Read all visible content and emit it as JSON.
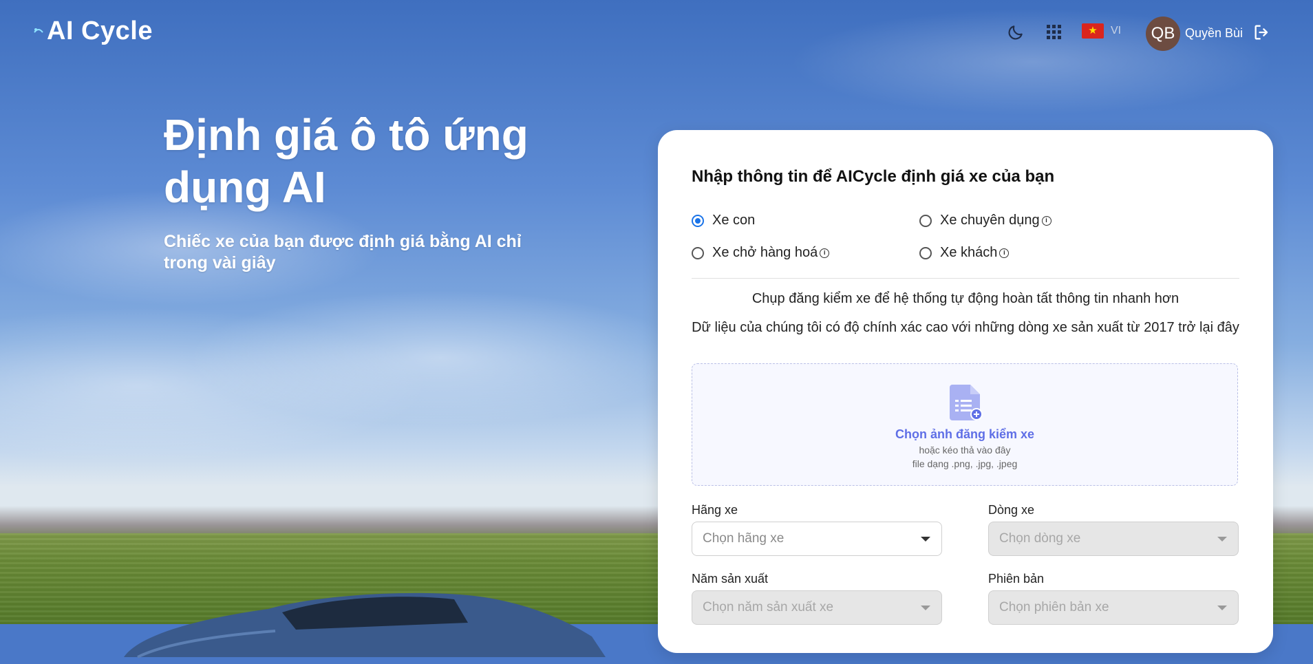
{
  "header": {
    "logo_text": "AI Cycle",
    "icons": [
      "moon-icon",
      "apps-grid-icon",
      "logout-icon"
    ],
    "language": {
      "flag": "vietnam-flag-icon",
      "code": "VI"
    },
    "user": {
      "initials": "QB",
      "name": "Quyền Bùi"
    }
  },
  "hero": {
    "title": "Định giá ô tô ứng dụng AI",
    "subtitle": "Chiếc xe của bạn được định giá bằng AI chỉ trong vài giây"
  },
  "form": {
    "title": "Nhập thông tin để AICycle định giá xe của bạn",
    "vehicle_types": [
      {
        "label": "Xe con",
        "checked": true,
        "info": false
      },
      {
        "label": "Xe chuyên dụng",
        "checked": false,
        "info": true
      },
      {
        "label": "Xe chở hàng hoá",
        "checked": false,
        "info": true
      },
      {
        "label": "Xe khách",
        "checked": false,
        "info": true
      }
    ],
    "note_1": "Chụp đăng kiểm xe để hệ thống tự động hoàn tất thông tin nhanh hơn",
    "note_2": "Dữ liệu của chúng tôi có độ chính xác cao với những dòng xe sản xuất từ 2017 trở lại đây",
    "upload": {
      "title": "Chọn ảnh đăng kiểm xe",
      "hint": "hoặc kéo thả vào đây",
      "types": "file dạng .png, .jpg, .jpeg"
    },
    "fields": {
      "brand": {
        "label": "Hãng xe",
        "placeholder": "Chọn hãng xe"
      },
      "model": {
        "label": "Dòng xe",
        "placeholder": "Chọn dòng xe"
      },
      "year": {
        "label": "Năm sản xuất",
        "placeholder": "Chọn năm sản xuất xe"
      },
      "version": {
        "label": "Phiên bản",
        "placeholder": "Chọn phiên bản xe"
      }
    }
  },
  "colors": {
    "accent": "#1a73e8",
    "upload_accent": "#5f6fe6",
    "avatar": "#6d4c41"
  }
}
